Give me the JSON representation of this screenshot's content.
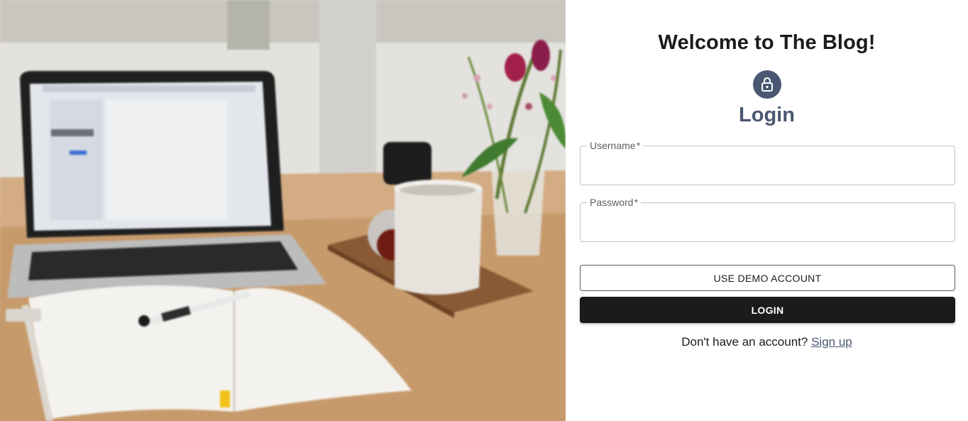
{
  "hero": {
    "image_name": "laptop-desk-photo"
  },
  "auth": {
    "welcome_title": "Welcome to The Blog!",
    "avatar_icon": "lock-icon",
    "heading": "Login",
    "username": {
      "label": "Username",
      "required_marker": "*",
      "value": ""
    },
    "password": {
      "label": "Password",
      "required_marker": "*",
      "value": ""
    },
    "demo_button_label": "USE DEMO ACCOUNT",
    "login_button_label": "LOGIN",
    "signup_prompt": "Don't have an account?",
    "signup_link_label": "Sign up"
  },
  "colors": {
    "accent": "#4a5772",
    "dark": "#1b1b1b",
    "border": "#c4c4c4"
  }
}
